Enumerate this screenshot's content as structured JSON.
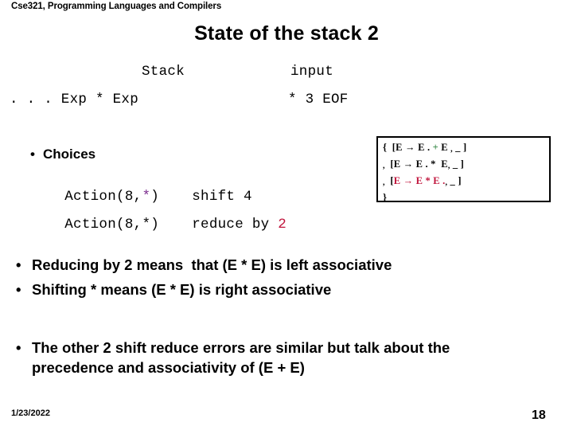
{
  "header": {
    "course": "Cse321, Programming Languages and Compilers"
  },
  "title": "State of the stack 2",
  "parser_state": {
    "stack_label": "Stack",
    "input_label": "input",
    "stack_value": ". . . Exp * Exp",
    "input_value": "* 3 EOF"
  },
  "choices": {
    "heading": "Choices",
    "bullet_glyph": "•",
    "rows": [
      {
        "action_prefix": "Action(8,",
        "action_symbol": "*",
        "action_suffix": ")",
        "symbol_color": "#7b2d8e",
        "decision": "shift 4",
        "decision_number": "",
        "number_color": ""
      },
      {
        "action_prefix": "Action(8,",
        "action_symbol": "*",
        "action_suffix": ")",
        "symbol_color": "#000000",
        "decision": "reduce by ",
        "decision_number": "2",
        "number_color": "#c0143c"
      }
    ]
  },
  "item_set": {
    "open_brace": "{",
    "close_brace": "}",
    "lines": [
      {
        "lead": "{",
        "open_bracket": "[",
        "lhs": "E",
        "arrow": "→",
        "rhs_before": "E",
        "dot": ".",
        "symbol": "+",
        "symbol_color": "#3a8a4a",
        "rhs_after": "E",
        "comma": ",",
        "lookahead": "_",
        "close_bracket": "]",
        "line_color": "#000000"
      },
      {
        "lead": ",",
        "open_bracket": "[",
        "lhs": "E",
        "arrow": "→",
        "rhs_before": "E",
        "dot": ".",
        "symbol": "*",
        "symbol_color": "#000000",
        "rhs_after": "E",
        "comma": ",",
        "lookahead": "_",
        "close_bracket": "]",
        "line_color": "#000000"
      },
      {
        "lead": ",",
        "open_bracket": "[",
        "lhs": "E",
        "arrow": "→",
        "rhs_before": "E",
        "dot": ".",
        "symbol": "*",
        "symbol_color": "#c0143c",
        "rhs_after": "E",
        "comma": ",",
        "lookahead": "_",
        "close_bracket": "]",
        "line_color": "#c0143c"
      }
    ]
  },
  "notes": {
    "group1": [
      "Reducing by 2 means  that (E * E) is left associative",
      "Shifting * means (E * E) is right associative"
    ],
    "group2": [
      "The other 2 shift reduce errors are similar but talk about the precedence and associativity of (E + E)"
    ],
    "bullet_glyph": "•"
  },
  "footer": {
    "date": "1/23/2022",
    "page": "18"
  },
  "colors": {
    "accent_purple": "#7b2d8e",
    "accent_crimson": "#c0143c",
    "accent_green": "#3a8a4a",
    "text": "#000000",
    "background": "#ffffff"
  }
}
